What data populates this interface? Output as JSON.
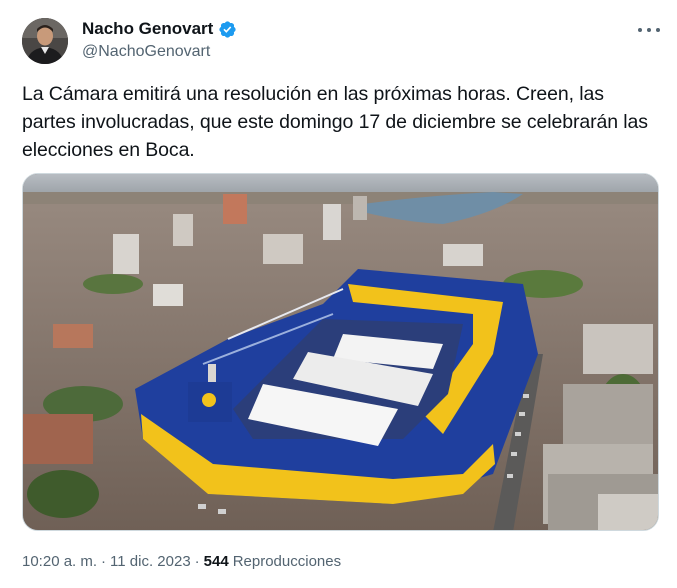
{
  "author": {
    "display_name": "Nacho Genovart",
    "handle": "@NachoGenovart",
    "verified": true,
    "avatar_icon": "profile-photo",
    "verified_icon": "verified-badge-icon",
    "verified_color": "#1d9bf0"
  },
  "tweet": {
    "text": "La Cámara emitirá una resolución en las próximas horas. Creen, las partes involucradas, que este domingo 17 de diciembre se celebrarán las elecciones en Boca."
  },
  "media": {
    "kind": "photo",
    "icon": "stadium-aerial-photo"
  },
  "meta": {
    "time": "10:20 a. m.",
    "separator": "·",
    "date": "11 dic. 2023",
    "views_count": "544",
    "views_label": "Reproducciones"
  },
  "colors": {
    "text_primary": "#0f1419",
    "text_secondary": "#536471",
    "stadium_blue": "#1f3f9e",
    "stadium_yellow": "#f2c21b"
  }
}
